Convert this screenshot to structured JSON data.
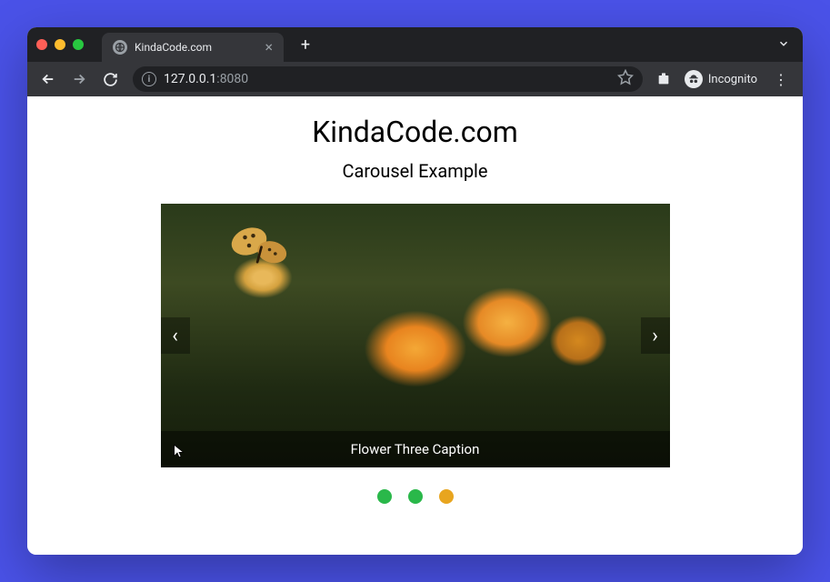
{
  "browser": {
    "tab": {
      "title": "KindaCode.com"
    },
    "url": {
      "host": "127.0.0.1",
      "port": ":8080"
    },
    "incognito_label": "Incognito"
  },
  "page": {
    "title": "KindaCode.com",
    "subtitle": "Carousel Example"
  },
  "carousel": {
    "caption": "Flower Three Caption",
    "prev_label": "‹",
    "next_label": "›",
    "active_index": 2,
    "indicators": [
      {
        "color": "#2ab84a"
      },
      {
        "color": "#2ab84a"
      },
      {
        "color": "#e8a51f"
      }
    ]
  }
}
